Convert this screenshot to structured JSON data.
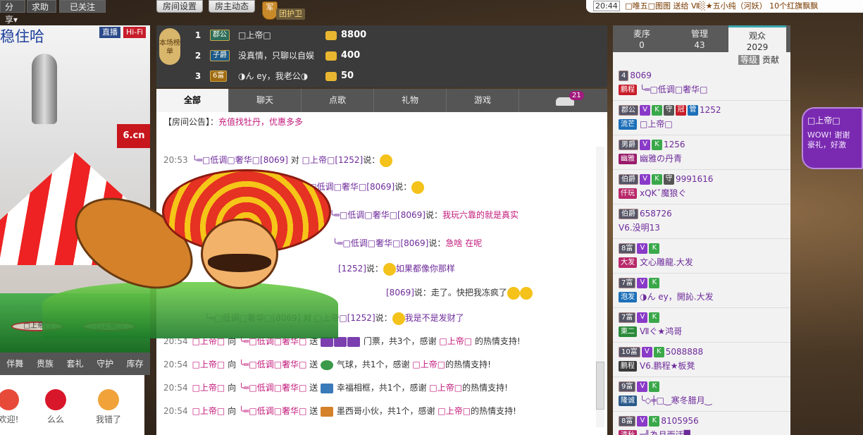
{
  "topbar": {
    "share_label": "分享▾",
    "help_label": "求助",
    "follow_label": "已关注",
    "room_settings_label": "房间设置",
    "host_updates_label": "房主动态",
    "guard_badge_text": "军",
    "guard_label": "团护卫",
    "ticker_time": "20:44",
    "ticker_text": "□唯五□图图 送给 Ⅶ░★五小纯（河妖） 10个红旗飘飘"
  },
  "video": {
    "title": "稳住哈",
    "tag_live": "直播",
    "tag_hifi": "Hi-Fi",
    "flag_text": "6.cn",
    "seat1_label": "□上帝□",
    "seat2_label": "□上帝□"
  },
  "gift_tabs": [
    "伴舞",
    "贵族",
    "套礼",
    "守护",
    "库存"
  ],
  "gifts": [
    {
      "label": "欢迎!",
      "color": "#e84a3a"
    },
    {
      "label": "么么",
      "color": "#d8182a"
    },
    {
      "label": "我错了",
      "color": "#f1a33a"
    }
  ],
  "rank": {
    "side_label": "本场榜单",
    "rows": [
      {
        "num": "1",
        "level": "郡公",
        "name": "□上帝□",
        "value": "8800"
      },
      {
        "num": "2",
        "level": "子爵",
        "name": "没真情，只聊以自娱",
        "value": "400"
      },
      {
        "num": "3",
        "level": "6富",
        "name": "◑ん ey，我老公◑",
        "value": "50"
      }
    ]
  },
  "chat": {
    "tabs": [
      "全部",
      "聊天",
      "点歌",
      "礼物",
      "游戏"
    ],
    "car_count": "21",
    "notice_label": "【房间公告】：",
    "notice_text": "充值找牡丹，优惠多多",
    "messages": [
      {
        "time": "20:53",
        "from": "╰═□低调□奢华□[8069]",
        "verb": "对",
        "to": "□上帝□[1252]",
        "say": "说：",
        "text": ""
      },
      {
        "time": "",
        "from": "",
        "verb": "对",
        "to": "╰═□低调□奢华□[8069]",
        "say": "说：",
        "text": ""
      },
      {
        "time": "",
        "from": "[1252]",
        "verb": "对",
        "to": "╰═□低调□奢华□[8069]",
        "say": "说：",
        "text": "我玩六靠的就是真实"
      },
      {
        "time": "",
        "from": "",
        "verb": "",
        "to": "╰═□低调□奢华□[8069]",
        "say": "说：",
        "text": "急啥 在呢"
      },
      {
        "time": "",
        "from": "",
        "verb": "",
        "to": "[1252]",
        "say": "说：",
        "text": "如果都像你那样"
      },
      {
        "time": "",
        "from": "",
        "verb": "",
        "to": "[8069]",
        "say": "说：",
        "text": "走了。快把我冻疯了"
      },
      {
        "time": "",
        "from": "╰═□低调□奢华□[8069]",
        "verb": "对",
        "to": "□上帝□[1252]",
        "say": "说：",
        "text": "我是不是发财了"
      }
    ],
    "gift_messages": [
      {
        "time": "20:54",
        "from": "□上帝□",
        "verb": "向",
        "to": "╰═□低调□奢华□",
        "send": "送",
        "gift": "门票，共3个，感谢",
        "thanks_name": "□上帝□",
        "tail": "的热情支持!"
      },
      {
        "time": "20:54",
        "from": "□上帝□",
        "verb": "向",
        "to": "╰═□低调□奢华□",
        "send": "送",
        "gift": "气球，共1个，感谢",
        "thanks_name": "□上帝□",
        "tail": "的热情支持!"
      },
      {
        "time": "20:54",
        "from": "□上帝□",
        "verb": "向",
        "to": "╰═□低调□奢华□",
        "send": "送",
        "gift": "幸福相框，共1个，感谢",
        "thanks_name": "□上帝□",
        "tail": "的热情支持!"
      },
      {
        "time": "20:54",
        "from": "□上帝□",
        "verb": "向",
        "to": "╰═□低调□奢华□",
        "send": "送",
        "gift": "墨西哥小伙，共1个，感谢",
        "thanks_name": "□上帝□",
        "tail": "的热情支持!"
      }
    ]
  },
  "right": {
    "tabs": [
      {
        "label": "麦序",
        "count": "0"
      },
      {
        "label": "管理",
        "count": "43"
      },
      {
        "label": "观众",
        "count": "2029"
      }
    ],
    "sort_level": "等级",
    "sort_contrib": "贡献",
    "users": [
      {
        "lvl": "4",
        "id": "8069",
        "tag": "鹏程",
        "tagcolor": "#c81d2a",
        "name": "╰═□低调□奢华□",
        "icons": ""
      },
      {
        "lvl": "郡公",
        "id": "1252",
        "tag": "流芒",
        "tagcolor": "#1c6fb8",
        "name": "□上帝□",
        "icons": "V K 守 冠 管"
      },
      {
        "lvl": "男爵",
        "id": "1256",
        "tag": "幽雅",
        "tagcolor": "#9a1b6a",
        "name": "幽雅の丹青",
        "icons": "V K"
      },
      {
        "lvl": "伯爵",
        "id": "9991616",
        "tag": "仟玩",
        "tagcolor": "#b8286a",
        "name": "ⅹQKˇ魔狼ぐ",
        "icons": "V K 守"
      },
      {
        "lvl": "伯爵",
        "id": "658726",
        "tag": "",
        "tagcolor": "",
        "name": "V6.没明13",
        "icons": ""
      },
      {
        "lvl": "8富",
        "id": "",
        "tag": "大发",
        "tagcolor": "#b8286a",
        "name": "文心雕龍.大发",
        "icons": "V K"
      },
      {
        "lvl": "7富",
        "id": "",
        "tag": "泡发",
        "tagcolor": "#1c6fb8",
        "name": "◑ん ey，開訫.大发",
        "icons": "V K"
      },
      {
        "lvl": "7富",
        "id": "",
        "tag": "東二",
        "tagcolor": "#2a8a3a",
        "name": "Ⅶぐ★鸿哥",
        "icons": "V K"
      },
      {
        "lvl": "10富",
        "id": "5088888",
        "tag": "鹏程",
        "tagcolor": "#3a3a3a",
        "name": "V6.鹏程★板凳",
        "icons": "V K"
      },
      {
        "lvl": "9富",
        "id": "",
        "tag": "隆诚",
        "tagcolor": "#2a5a8a",
        "name": "╰◇╪□‿寒冬腊月‿",
        "icons": "V K"
      },
      {
        "lvl": "8富",
        "id": "8105956",
        "tag": "清秋",
        "tagcolor": "#b8286a",
        "name": "═╣為月而活█",
        "icons": "V K"
      }
    ]
  },
  "promo": {
    "header": "□上帝□",
    "body": "WOW! 谢谢豪礼，好激"
  }
}
